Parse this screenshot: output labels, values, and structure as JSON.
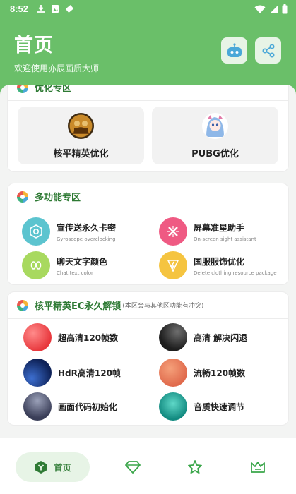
{
  "status": {
    "time": "8:52",
    "left_icons": [
      "download-icon",
      "image-icon",
      "tag-icon"
    ],
    "right_icons": [
      "wifi-icon",
      "signal-icon",
      "battery-icon"
    ]
  },
  "header": {
    "title": "首页",
    "subtitle": "欢迎使用亦辰画质大师",
    "buttons": [
      "robot-icon",
      "share-icon"
    ],
    "accent": "#6abf69"
  },
  "optimize": {
    "title": "优化专区",
    "tiles": [
      {
        "label": "核平精英优化"
      },
      {
        "label": "PUBG优化"
      }
    ]
  },
  "multi": {
    "title": "多功能专区",
    "items": [
      {
        "title": "宣传送永久卡密",
        "subtitle": "Gyroscope overclocking",
        "color": "#5cc4cf"
      },
      {
        "title": "屏幕准星助手",
        "subtitle": "On-screen sight assistant",
        "color": "#ef5a83"
      },
      {
        "title": "聊天文字颜色",
        "subtitle": "Chat text color",
        "color": "#a8d95f"
      },
      {
        "title": "国服服饰优化",
        "subtitle": "Delete clothing resource package",
        "color": "#f5c440"
      }
    ]
  },
  "ec": {
    "title": "核平精英EC永久解锁",
    "note": "(本区会与其他区功能有冲突)",
    "items": [
      {
        "title": "超高清120帧数"
      },
      {
        "title": "高清 解决闪退"
      },
      {
        "title": "HdR高清120帧"
      },
      {
        "title": "流畅120帧数"
      },
      {
        "title": "画面代码初始化"
      },
      {
        "title": "音质快速调节"
      }
    ]
  },
  "nav": {
    "home_label": "首页",
    "icons": [
      "home-icon",
      "diamond-icon",
      "star-icon",
      "crown-icon"
    ]
  }
}
